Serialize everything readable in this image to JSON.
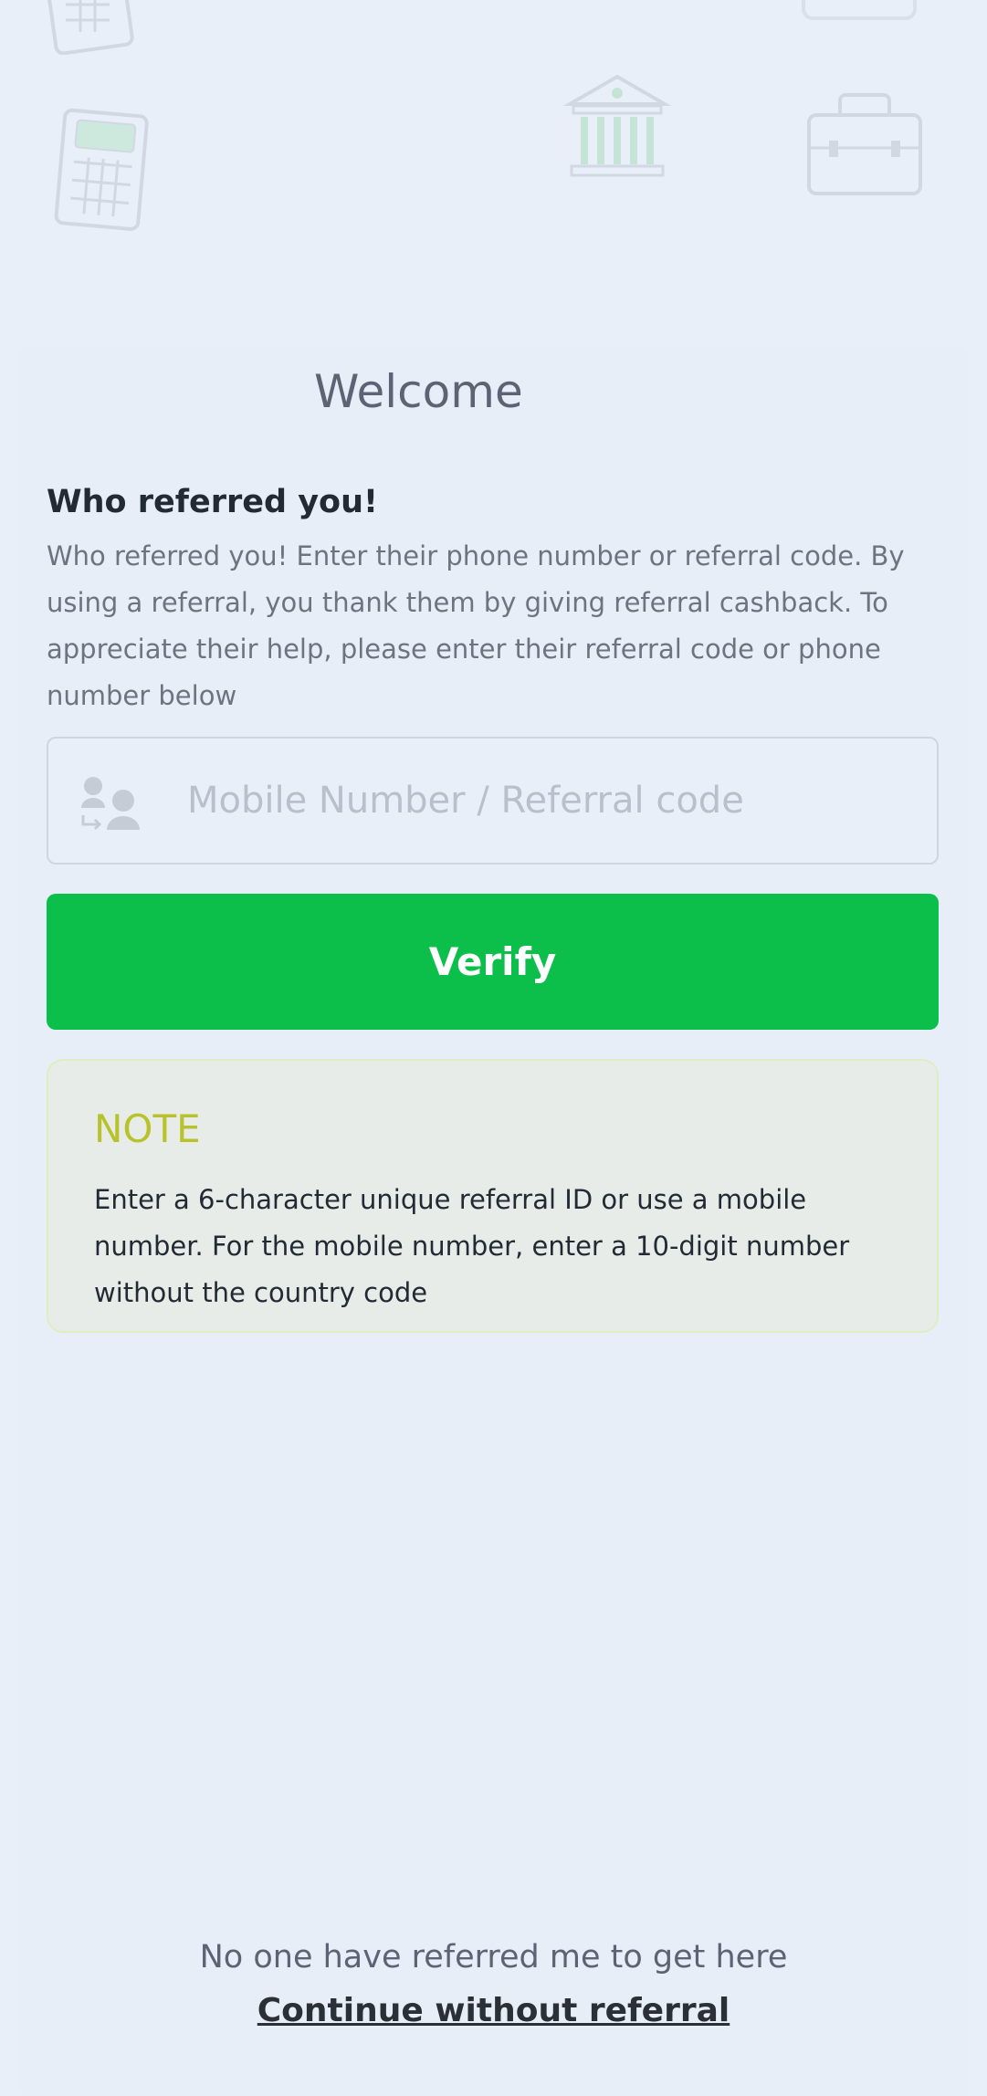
{
  "background": {
    "icons": [
      "calculator-icon",
      "calculator-icon",
      "bank-icon",
      "briefcase-icon"
    ]
  },
  "header": {
    "title": "Welcome"
  },
  "referral": {
    "heading": "Who referred you!",
    "description": "Who referred you! Enter their phone number or referral code. By using a referral, you thank them by giving referral cashback. To appreciate their help, please enter their referral code or phone number below",
    "input_icon": "user-referral-icon",
    "input_placeholder": "Mobile Number / Referral code",
    "input_value": "",
    "verify_label": "Verify"
  },
  "note": {
    "title": "NOTE",
    "text": "Enter a 6-character unique referral ID or use a mobile number. For the mobile number, enter a 10-digit number without the country code"
  },
  "footer": {
    "prompt": "No one have referred me to get here",
    "link_label": "Continue without referral"
  },
  "colors": {
    "background": "#e8eff8",
    "primary_button": "#0cbf4a",
    "note_title": "#b8c22a",
    "note_background": "#e7ece9",
    "placeholder": "#b8c0cb"
  }
}
